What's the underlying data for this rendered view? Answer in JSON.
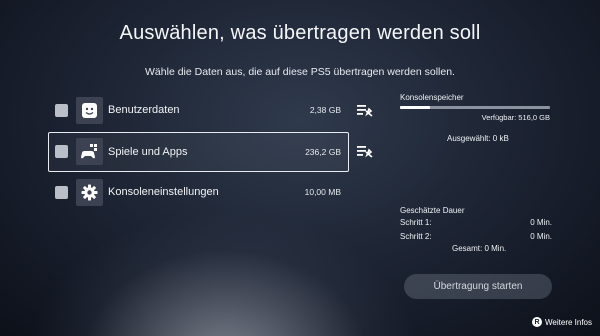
{
  "header": {
    "title": "Auswählen, was übertragen werden soll",
    "subtitle": "Wähle die Daten aus, die auf diese PS5 übertragen werden sollen."
  },
  "items": [
    {
      "label": "Benutzerdaten",
      "size": "2,38 GB",
      "icon": "user-face-icon",
      "checked": false,
      "has_details": true,
      "focused": false
    },
    {
      "label": "Spiele und Apps",
      "size": "236,2 GB",
      "icon": "gamepad-apps-icon",
      "checked": false,
      "has_details": true,
      "focused": true
    },
    {
      "label": "Konsoleneinstellungen",
      "size": "10,00 MB",
      "icon": "gear-icon",
      "checked": false,
      "has_details": false,
      "focused": false
    }
  ],
  "storage": {
    "label": "Konsolenspeicher",
    "available": "Verfügbar: 516,0 GB",
    "used_fraction": 0.2,
    "selected": "Ausgewählt: 0 kB"
  },
  "duration": {
    "label": "Geschätzte Dauer",
    "step1_label": "Schritt 1:",
    "step1_value": "0 Min.",
    "step2_label": "Schritt 2:",
    "step2_value": "0 Min.",
    "total": "Gesamt: 0 Min."
  },
  "start_button": {
    "label": "Übertragung starten",
    "enabled": false
  },
  "footer": {
    "info_label": "Weitere Infos",
    "info_glyph": "R"
  },
  "colors": {
    "background": "#1b2231",
    "checkbox": "#b9bec7",
    "tile": "#3c4251",
    "focus_border": "#e9edf3"
  }
}
